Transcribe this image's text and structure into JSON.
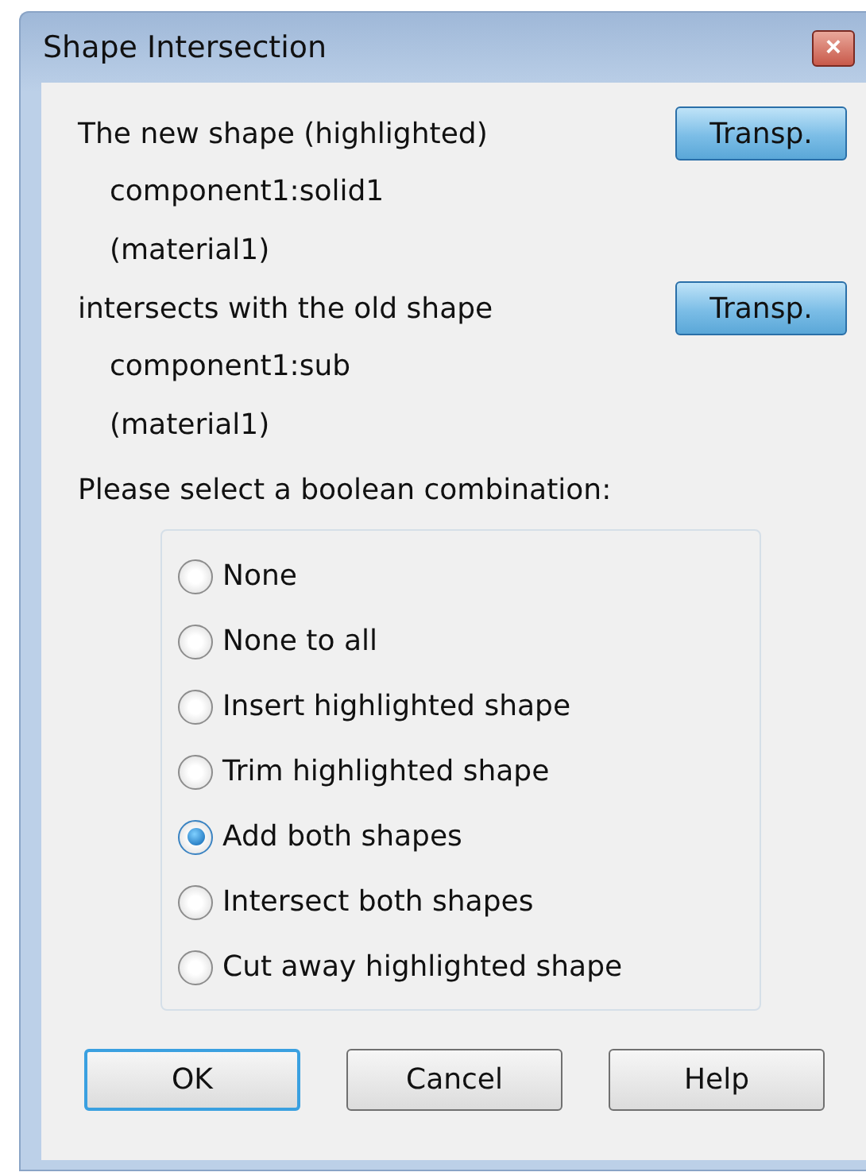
{
  "window": {
    "title": "Shape Intersection",
    "close": "×"
  },
  "shapes": [
    {
      "label": "The new shape (highlighted)",
      "name": "component1:solid1",
      "material": "(material1)",
      "button": "Transp."
    },
    {
      "label": "intersects with the old shape",
      "name": "component1:sub",
      "material": "(material1)",
      "button": "Transp."
    }
  ],
  "prompt": "Please select a boolean combination:",
  "options": [
    {
      "label": "None",
      "selected": false
    },
    {
      "label": "None to all",
      "selected": false
    },
    {
      "label": "Insert highlighted shape",
      "selected": false
    },
    {
      "label": "Trim highlighted shape",
      "selected": false
    },
    {
      "label": "Add both shapes",
      "selected": true
    },
    {
      "label": "Intersect both shapes",
      "selected": false
    },
    {
      "label": "Cut away highlighted shape",
      "selected": false
    }
  ],
  "buttons": [
    {
      "label": "OK",
      "default": true
    },
    {
      "label": "Cancel",
      "default": false
    },
    {
      "label": "Help",
      "default": false
    }
  ]
}
